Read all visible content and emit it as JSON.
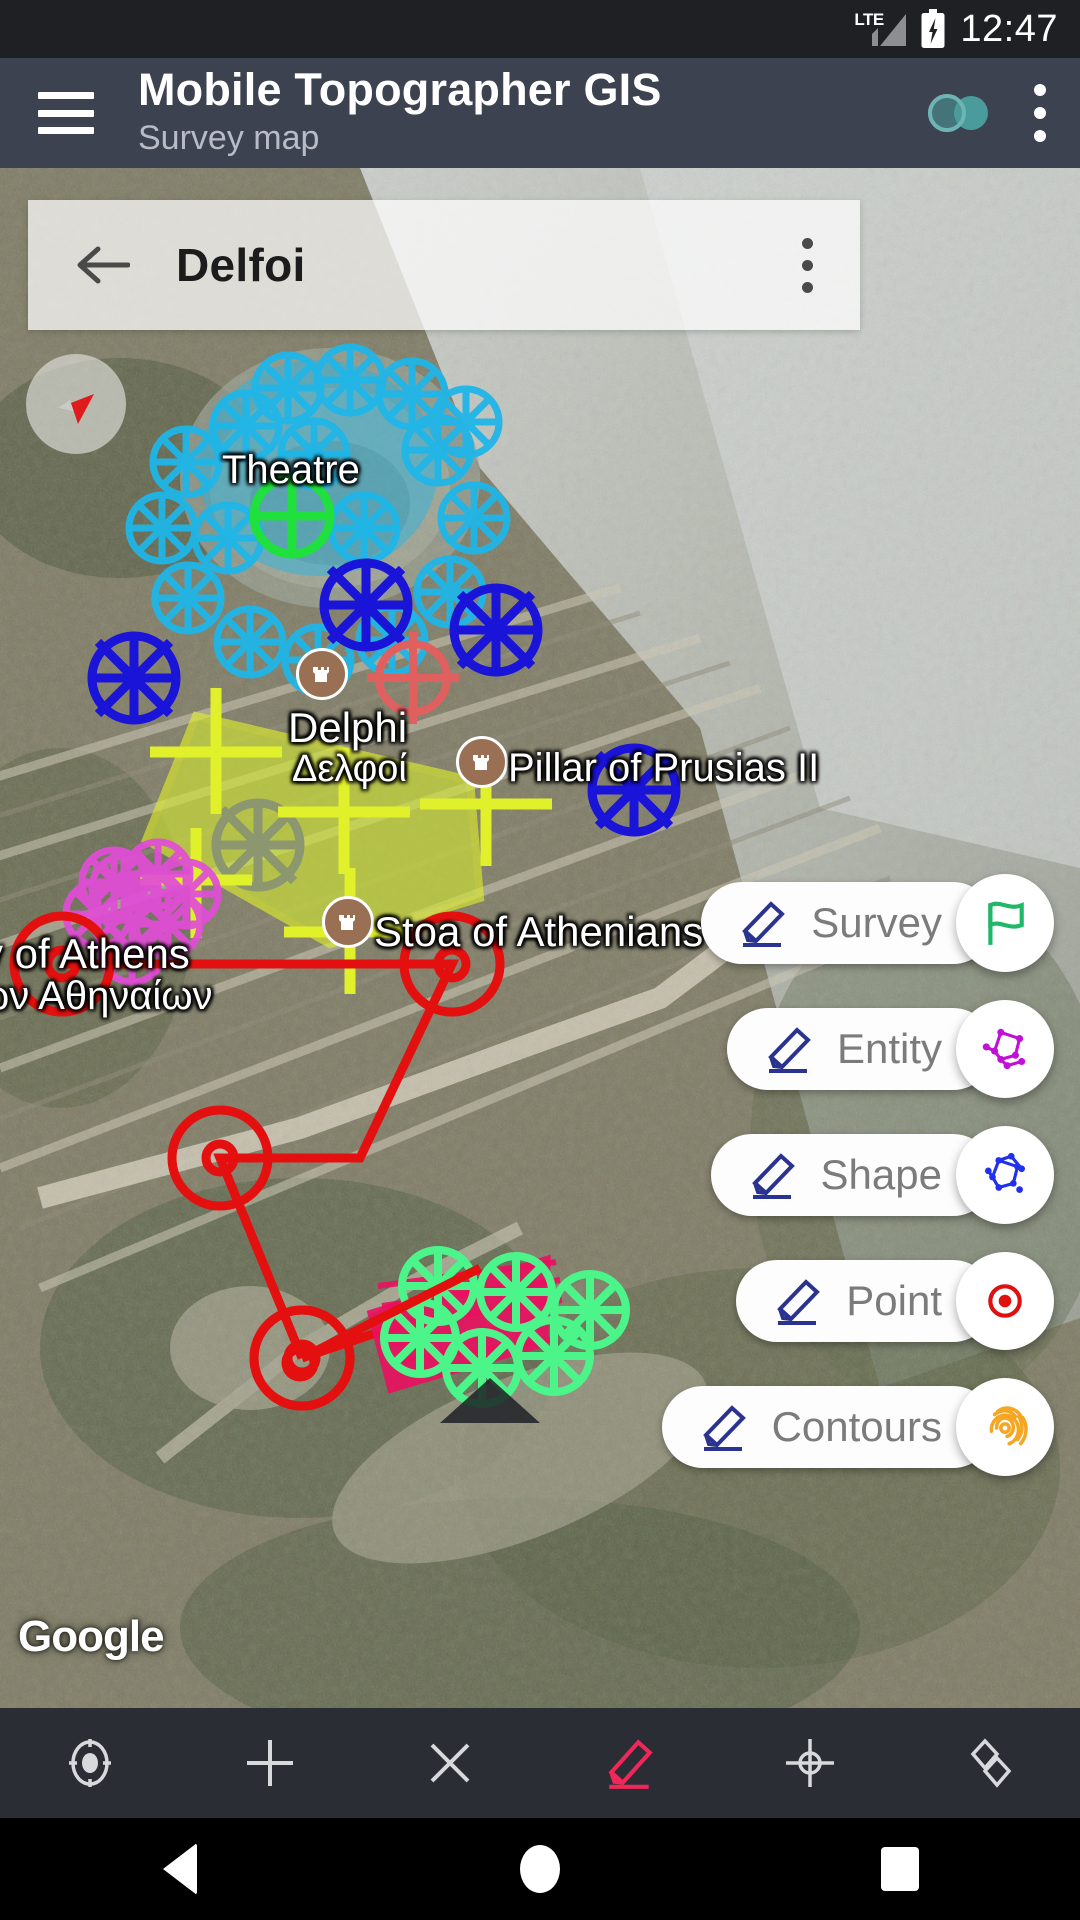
{
  "statusbar": {
    "network_label": "LTE",
    "time": "12:47",
    "battery_icon": "battery-charging-icon",
    "signal_icon": "signal-bars-icon"
  },
  "appbar": {
    "menu_icon": "hamburger-menu-icon",
    "title": "Mobile Topographer GIS",
    "subtitle": "Survey map",
    "link_icon": "link-connect-icon",
    "link_icon_color": "#4a9c9c",
    "overflow_icon": "overflow-menu-icon",
    "background": "#3d4250"
  },
  "search": {
    "back_icon": "back-arrow-icon",
    "title": "Delfoi",
    "overflow_icon": "overflow-menu-icon"
  },
  "map": {
    "compass_icon": "compass-needle-icon",
    "compass_needle_color": "#e01b1b",
    "attribution": "Google",
    "labels": [
      {
        "text": "Theatre",
        "name": "map-label-theatre"
      },
      {
        "text": "Delphi",
        "name": "map-label-delphi"
      },
      {
        "text": "Δελφοί",
        "name": "map-label-delphi-greek"
      },
      {
        "text": "Pillar of Prusias II",
        "name": "map-label-pillar-of-prusias"
      },
      {
        "text": "Stoa of Athenians",
        "name": "map-label-stoa-of-athenians"
      },
      {
        "text": "y of Athens",
        "name": "map-label-treasury-of-athens"
      },
      {
        "text": "ων Αθηναίων",
        "name": "map-label-treasury-of-athens-greek"
      }
    ],
    "layer_colors": {
      "theatre_survey": "#1fb6e8",
      "theatre_point": "#1fe03c",
      "entity_blue": "#1a13d8",
      "polygon_yellow": "#d2e832",
      "treasury_magenta": "#e24cd8",
      "track_red": "#e41010",
      "stadium_pink": "#ea1060",
      "stadium_green": "#4cf58a",
      "crosshair_red": "#e06060"
    }
  },
  "fab_menu": {
    "pencil_icon": "pencil-edit-icon",
    "items": [
      {
        "label": "Survey",
        "icon": "flag-icon",
        "icon_color": "#1fb868",
        "name": "fab-survey"
      },
      {
        "label": "Entity",
        "icon": "entity-polygon-icon",
        "icon_color": "#c210d8",
        "name": "fab-entity"
      },
      {
        "label": "Shape",
        "icon": "shape-polygon-icon",
        "icon_color": "#2030ee",
        "name": "fab-shape"
      },
      {
        "label": "Point",
        "icon": "point-target-icon",
        "icon_color": "#e01010",
        "name": "fab-point"
      },
      {
        "label": "Contours",
        "icon": "contours-icon",
        "icon_color": "#f5a623",
        "name": "fab-contours"
      }
    ]
  },
  "bottom_toolbar": {
    "background": "#2a2d33",
    "items": [
      {
        "icon": "my-location-icon",
        "name": "toolbar-my-location",
        "color": "#d7d9dd",
        "active": false
      },
      {
        "icon": "add-plus-icon",
        "name": "toolbar-add",
        "color": "#d7d9dd",
        "active": false
      },
      {
        "icon": "close-x-icon",
        "name": "toolbar-delete",
        "color": "#d7d9dd",
        "active": false
      },
      {
        "icon": "pencil-edit-icon",
        "name": "toolbar-edit",
        "color": "#f0285a",
        "active": true
      },
      {
        "icon": "crosshair-target-icon",
        "name": "toolbar-center",
        "color": "#d7d9dd",
        "active": false
      },
      {
        "icon": "layers-icon",
        "name": "toolbar-layers",
        "color": "#d7d9dd",
        "active": false
      }
    ]
  },
  "navbar": {
    "background": "#000000",
    "items": [
      {
        "icon": "nav-back-icon",
        "name": "android-nav-back"
      },
      {
        "icon": "nav-home-icon",
        "name": "android-nav-home"
      },
      {
        "icon": "nav-recents-icon",
        "name": "android-nav-recents"
      }
    ]
  }
}
